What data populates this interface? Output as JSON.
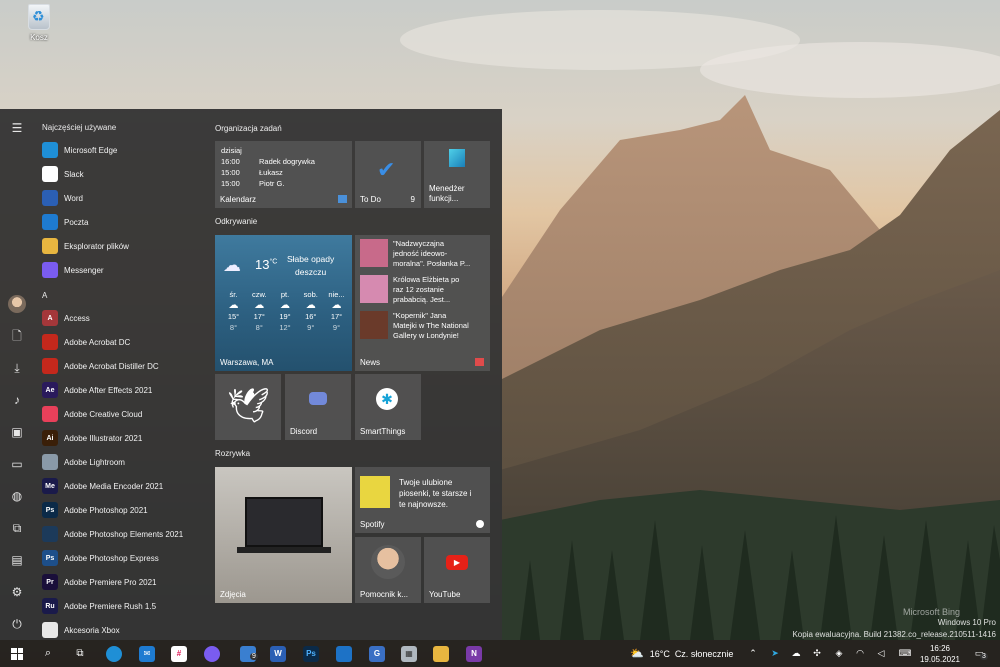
{
  "desktop": {
    "recycle_bin_label": "Kosz",
    "bing_mark": "Microsoft Bing",
    "watermark_line1": "Windows 10 Pro",
    "watermark_line2": "Kopia ewaluacyjna. Build 21382.co_release.210511-1416"
  },
  "start_menu": {
    "recent_header": "Najczęściej używane",
    "recent_apps": [
      {
        "label": "Microsoft Edge",
        "icon": "edge-icon",
        "color": "#1f8fd6"
      },
      {
        "label": "Slack",
        "icon": "slack-icon",
        "color": "#ffffff"
      },
      {
        "label": "Word",
        "icon": "word-icon",
        "color": "#2b5fb4"
      },
      {
        "label": "Poczta",
        "icon": "mail-icon",
        "color": "#1e7bd1"
      },
      {
        "label": "Eksplorator plików",
        "icon": "file-explorer-icon",
        "color": "#e8b640"
      },
      {
        "label": "Messenger",
        "icon": "messenger-icon",
        "color": "#7a5cf0"
      }
    ],
    "section_a": "A",
    "apps_a": [
      {
        "label": "Access",
        "abbr": "A",
        "color": "#a4373a"
      },
      {
        "label": "Adobe Acrobat DC",
        "abbr": "",
        "color": "#c4281c"
      },
      {
        "label": "Adobe Acrobat Distiller DC",
        "abbr": "",
        "color": "#c4281c"
      },
      {
        "label": "Adobe After Effects 2021",
        "abbr": "Ae",
        "color": "#2a1a5c"
      },
      {
        "label": "Adobe Creative Cloud",
        "abbr": "",
        "color": "#e8405a"
      },
      {
        "label": "Adobe Illustrator 2021",
        "abbr": "Ai",
        "color": "#3a1f08"
      },
      {
        "label": "Adobe Lightroom",
        "abbr": "",
        "color": "#8a9aa8"
      },
      {
        "label": "Adobe Media Encoder 2021",
        "abbr": "Me",
        "color": "#1a1a4a"
      },
      {
        "label": "Adobe Photoshop 2021",
        "abbr": "Ps",
        "color": "#0b2a48"
      },
      {
        "label": "Adobe Photoshop Elements 2021",
        "abbr": "",
        "color": "#1c3a5a"
      },
      {
        "label": "Adobe Photoshop Express",
        "abbr": "Ps",
        "color": "#1d4f8a"
      },
      {
        "label": "Adobe Premiere Pro 2021",
        "abbr": "Pr",
        "color": "#1a0f3a"
      },
      {
        "label": "Adobe Premiere Rush 1.5",
        "abbr": "Ru",
        "color": "#1a1a4a"
      },
      {
        "label": "Akcesoria Xbox",
        "abbr": "",
        "color": "#e8e8e8"
      }
    ]
  },
  "tiles": {
    "group1": "Organizacja zadań",
    "calendar": {
      "day": "dzisiaj",
      "events": [
        {
          "time": "16:00",
          "title": "Radek dogrywka"
        },
        {
          "time": "15:00",
          "title": "Łukasz"
        },
        {
          "time": "15:00",
          "title": "Piotr G."
        }
      ],
      "label": "Kalendarz"
    },
    "todo": {
      "label": "To Do",
      "count": "9"
    },
    "task_manager": {
      "line1": "Menedżer",
      "line2": "funkcji..."
    },
    "group2": "Odkrywanie",
    "weather": {
      "temp": "13",
      "unit": "°C",
      "desc1": "Słabe opady",
      "desc2": "deszczu",
      "days": [
        {
          "name": "śr.",
          "hi": "15°",
          "lo": "8°"
        },
        {
          "name": "czw.",
          "hi": "17°",
          "lo": "8°"
        },
        {
          "name": "pt.",
          "hi": "19°",
          "lo": "12°"
        },
        {
          "name": "sob.",
          "hi": "16°",
          "lo": "9°"
        },
        {
          "name": "nie...",
          "hi": "17°",
          "lo": "9°"
        }
      ],
      "location": "Warszawa, MA"
    },
    "news": {
      "items": [
        {
          "line1": "\"Nadzwyczajna",
          "line2": "jedność ideowo-",
          "line3": "moralna\". Posłanka P..."
        },
        {
          "line1": "Królowa Elżbieta po",
          "line2": "raz 12 zostanie",
          "line3": "prababcią. Jest..."
        },
        {
          "line1": "\"Kopernik\" Jana",
          "line2": "Matejki w The National",
          "line3": "Gallery w Londynie!"
        }
      ],
      "label": "News"
    },
    "discord": {
      "label": "Discord"
    },
    "smartthings": {
      "label": "SmartThings"
    },
    "group3": "Rozrywka",
    "photos": {
      "label": "Zdjęcia"
    },
    "spotify": {
      "line1": "Twoje ulubione",
      "line2": "piosenki, te starsze i",
      "line3": "te najnowsze.",
      "label": "Spotify"
    },
    "assistant": {
      "label": "Pomocnik k..."
    },
    "youtube": {
      "label": "YouTube"
    }
  },
  "taskbar": {
    "weather_temp": "16°C",
    "weather_desc": "Cz. słonecznie",
    "time": "16:26",
    "date": "19.05.2021",
    "notifications": "3",
    "store_badge": "9"
  }
}
